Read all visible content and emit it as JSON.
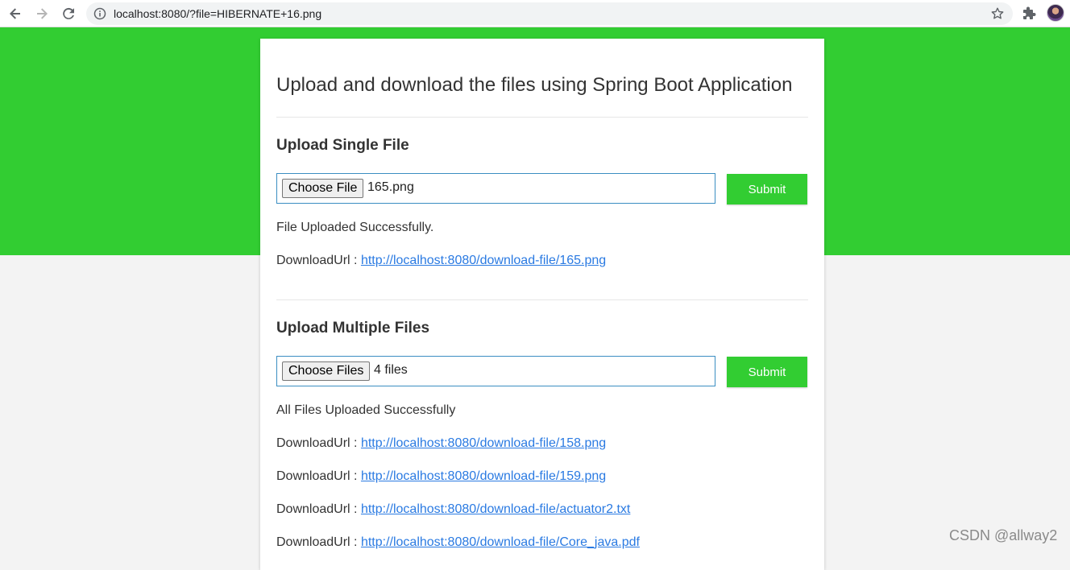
{
  "browser": {
    "url": "localhost:8080/?file=HIBERNATE+16.png"
  },
  "page": {
    "title": "Upload and download the files using Spring Boot Application"
  },
  "single_upload": {
    "heading": "Upload Single File",
    "choose_label": "Choose File",
    "selected_file": "165.png",
    "submit_label": "Submit",
    "status_message": "File Uploaded Successfully.",
    "download_rows": [
      {
        "prefix": "DownloadUrl : ",
        "link": "http://localhost:8080/download-file/165.png"
      }
    ]
  },
  "multiple_upload": {
    "heading": "Upload Multiple Files",
    "choose_label": "Choose Files",
    "selected_files": "4 files",
    "submit_label": "Submit",
    "status_message": "All Files Uploaded Successfully",
    "download_rows": [
      {
        "prefix": "DownloadUrl : ",
        "link": "http://localhost:8080/download-file/158.png"
      },
      {
        "prefix": "DownloadUrl : ",
        "link": "http://localhost:8080/download-file/159.png"
      },
      {
        "prefix": "DownloadUrl : ",
        "link": "http://localhost:8080/download-file/actuator2.txt"
      },
      {
        "prefix": "DownloadUrl : ",
        "link": "http://localhost:8080/download-file/Core_java.pdf"
      }
    ]
  },
  "watermark": "CSDN @allway2",
  "colors": {
    "accent_green": "#32cd32",
    "link_blue": "#2a7ae2",
    "input_border": "#3b8ec2"
  }
}
